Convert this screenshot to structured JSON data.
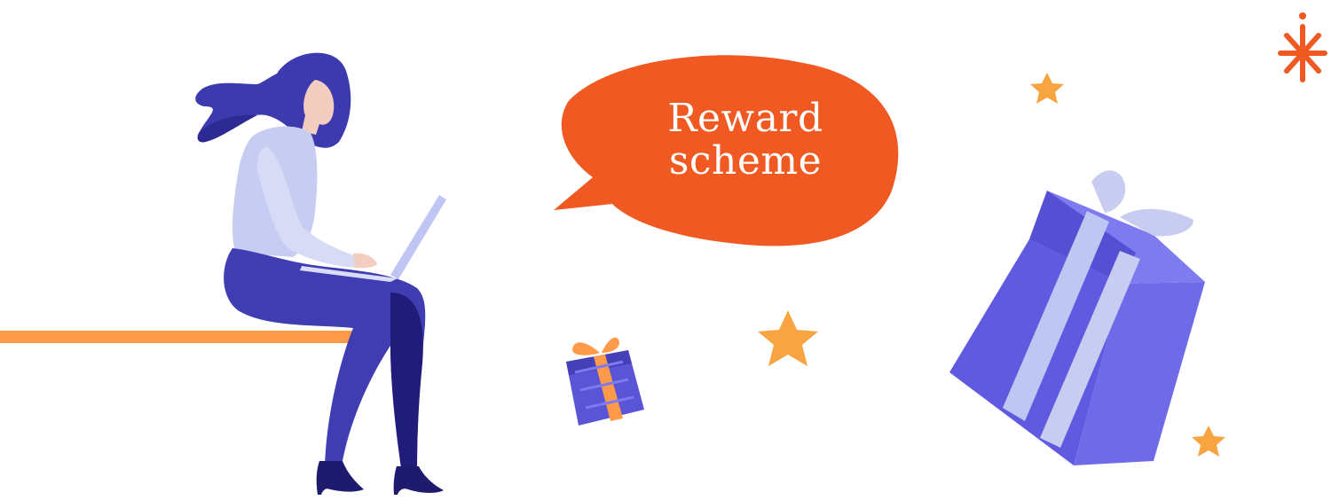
{
  "bubble": {
    "line1": "Reward",
    "line2": "scheme"
  },
  "colors": {
    "brand_orange": "#F05A22",
    "bench_orange": "#FF9A4A",
    "hair": "#3D3AB0",
    "pants": "#3F3DB1",
    "shoe": "#1E1A6E",
    "sweater": "#C7CCF3",
    "gift_purple": "#6F6BE8",
    "gift_ribbon": "#C7CCF0",
    "star": "#F7A441"
  },
  "icons": [
    "logo-asterisk-icon",
    "star-icon",
    "gift-icon",
    "laptop-icon"
  ]
}
